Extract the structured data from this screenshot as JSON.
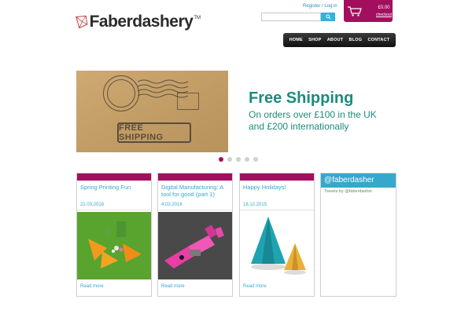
{
  "brand": {
    "name": "Faberdashery",
    "tm": "TM",
    "accent": "#a30f5e",
    "link_color": "#35a8cc"
  },
  "header": {
    "auth_text": "Register / Log in",
    "search_placeholder": "",
    "search_icon": "search-icon",
    "cart": {
      "amount": "£0.00",
      "checkout": "checkout",
      "icon": "cart-icon"
    }
  },
  "nav": {
    "items": [
      "HOME",
      "SHOP",
      "ABOUT",
      "BLOG",
      "CONTACT"
    ]
  },
  "banner": {
    "title": "Free Shipping",
    "line1": "On orders over £100 in the UK",
    "line2": "and £200 internationally",
    "stamp_text": "FREE SHIPPING",
    "slides": 5,
    "active_slide": 1
  },
  "posts": [
    {
      "title": "Spring Printing Fun",
      "date": "22.03.2016",
      "more": "Read more"
    },
    {
      "title": "Digital Manufacturing: A tool for good (part 1)",
      "date": "4.03.2016",
      "more": "Read more"
    },
    {
      "title": "Happy Holidays!",
      "date": "18.12.2015",
      "more": "Read more"
    }
  ],
  "twitter": {
    "handle": "@faberdasher",
    "sub": "Tweets by @faberdasher"
  }
}
